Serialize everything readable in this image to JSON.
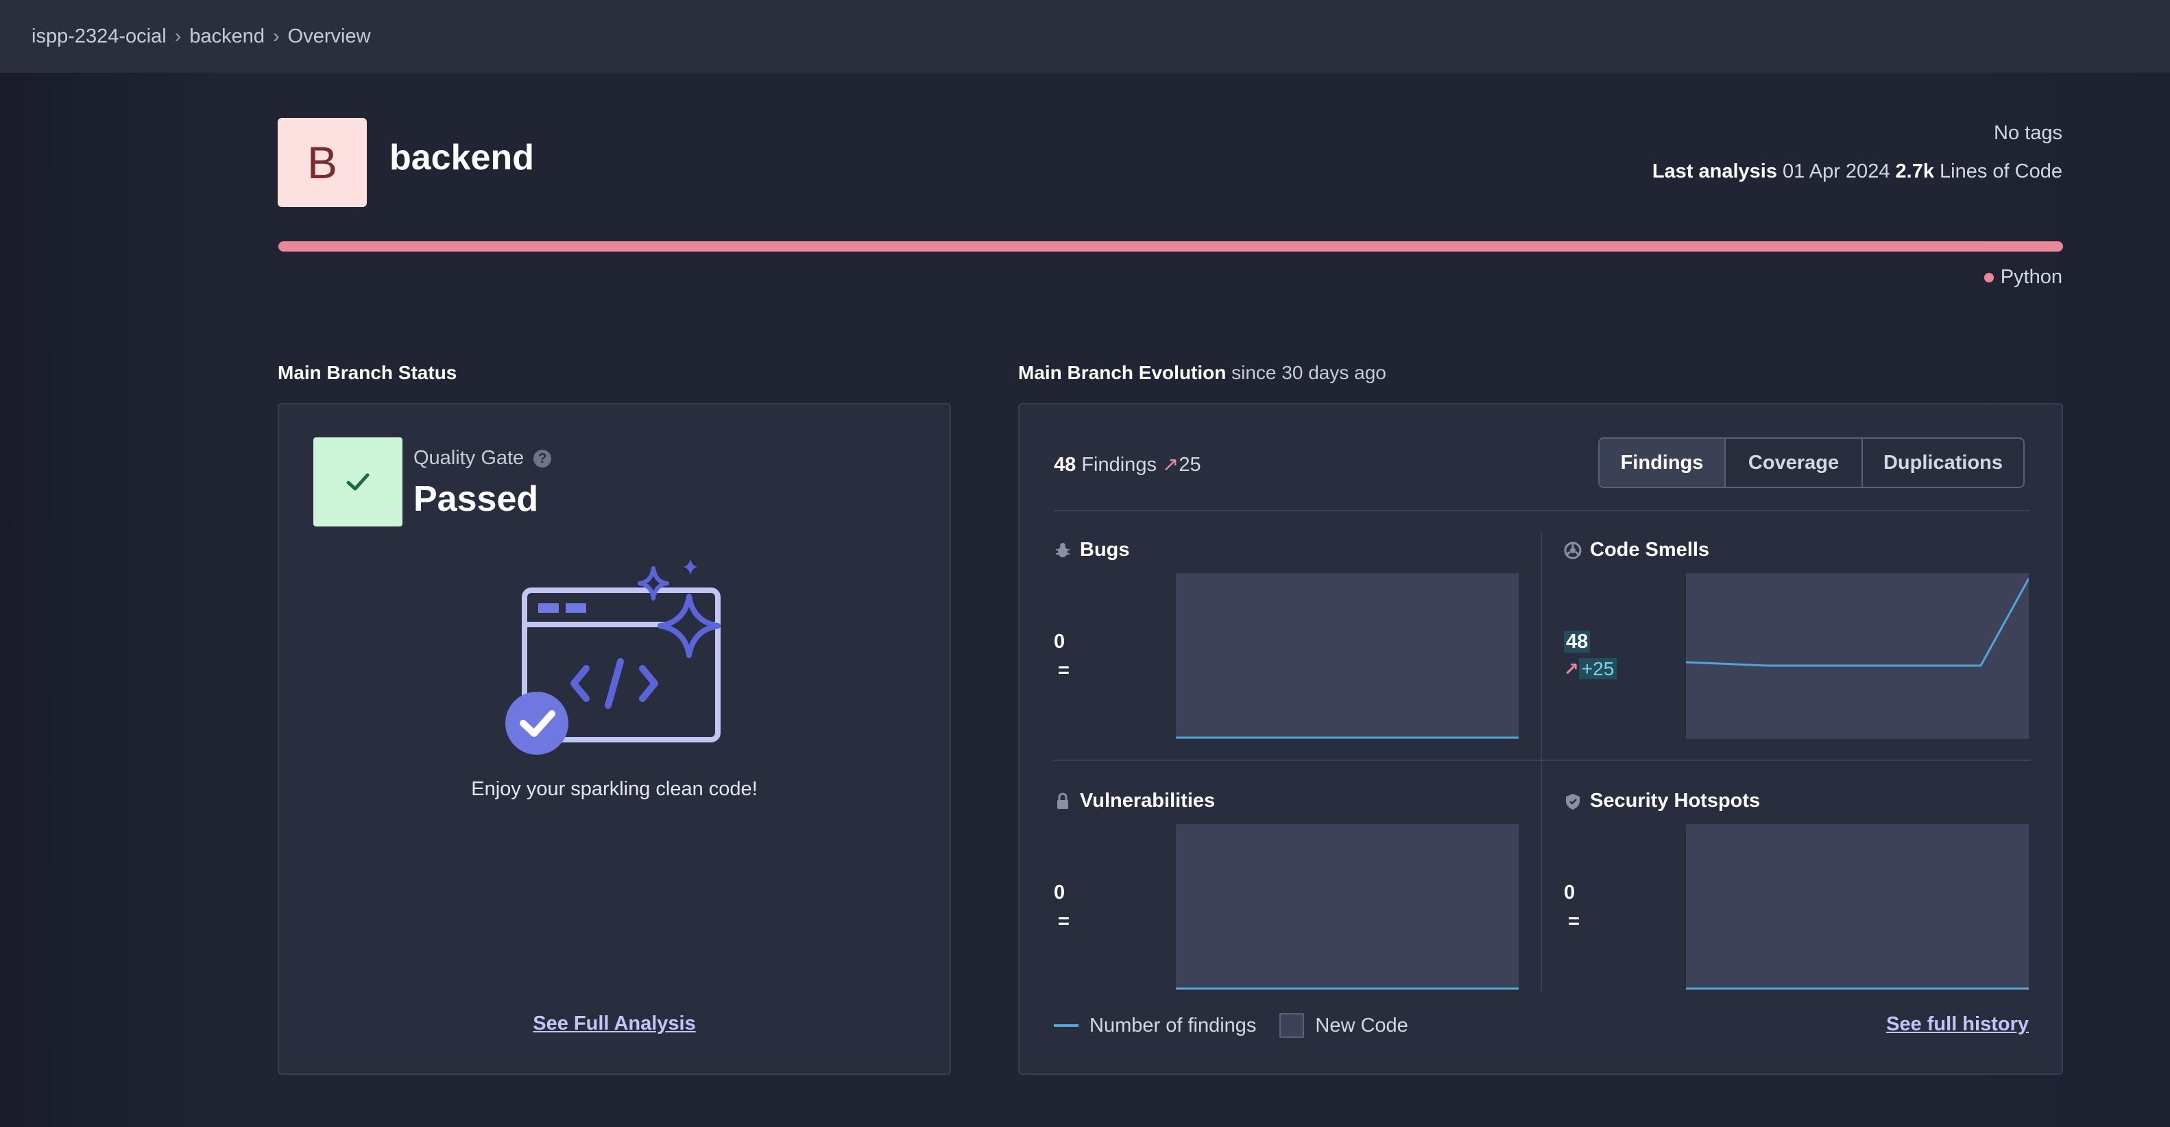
{
  "breadcrumb": [
    "ispp-2324-ocial",
    "backend",
    "Overview"
  ],
  "project": {
    "initial": "B",
    "name": "backend",
    "tags": "No tags",
    "last_analysis_label": "Last analysis",
    "last_analysis_date": "01 Apr 2024",
    "lines_value": "2.7k",
    "lines_label": "Lines of Code",
    "language": "Python"
  },
  "colors": {
    "language_bar": "#e8889a",
    "passed_bg": "#cdf5d7",
    "findings_line": "#4fa6d8",
    "accent": "#c2c6f5"
  },
  "status": {
    "title": "Main Branch Status",
    "quality_gate_label": "Quality Gate",
    "help_icon": "?",
    "quality_gate_value": "Passed",
    "message": "Enjoy your sparkling clean code!",
    "link": "See Full Analysis"
  },
  "evolution": {
    "title": "Main Branch Evolution",
    "since": "since 30 days ago",
    "findings_count": "48",
    "findings_label": "Findings",
    "findings_trend": "25",
    "tabs": [
      "Findings",
      "Coverage",
      "Duplications"
    ],
    "active_tab": "Findings",
    "metrics": [
      {
        "name": "Bugs",
        "icon": "bug-icon",
        "value": "0",
        "delta": "="
      },
      {
        "name": "Code Smells",
        "icon": "code-smell-icon",
        "value": "48",
        "delta": "+25"
      },
      {
        "name": "Vulnerabilities",
        "icon": "lock-icon",
        "value": "0",
        "delta": "="
      },
      {
        "name": "Security Hotspots",
        "icon": "shield-icon",
        "value": "0",
        "delta": "="
      }
    ],
    "legend_findings": "Number of findings",
    "legend_new_code": "New Code",
    "history_link": "See full history"
  }
}
